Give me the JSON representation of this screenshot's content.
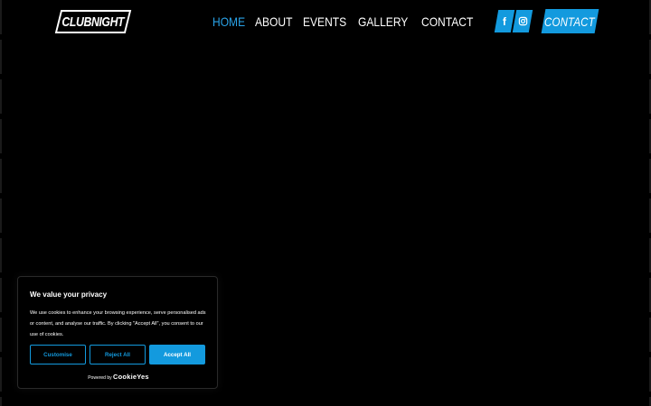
{
  "header": {
    "logo_text": "CLUBNIGHT",
    "nav": [
      {
        "label": "HOME",
        "active": true
      },
      {
        "label": "ABOUT",
        "active": false
      },
      {
        "label": "EVENTS",
        "active": false
      },
      {
        "label": "GALLERY",
        "active": false
      },
      {
        "label": "CONTACT",
        "active": false
      }
    ],
    "social": [
      {
        "icon": "facebook-icon",
        "glyph": "f"
      },
      {
        "icon": "instagram-icon"
      }
    ],
    "contact_button": "CONTACT"
  },
  "colors": {
    "accent": "#139ade",
    "nav_active": "#2aa3e8",
    "background": "#000000"
  },
  "cookie_banner": {
    "title": "We value your privacy",
    "body": "We use cookies to enhance your browsing experience, serve personalised ads or content, and analyse our traffic. By clicking \"Accept All\", you consent to our use of cookies.",
    "buttons": {
      "customise": "Customise",
      "reject": "Reject All",
      "accept": "Accept All"
    },
    "powered_by": "Powered by",
    "brand": "CookieYes"
  }
}
